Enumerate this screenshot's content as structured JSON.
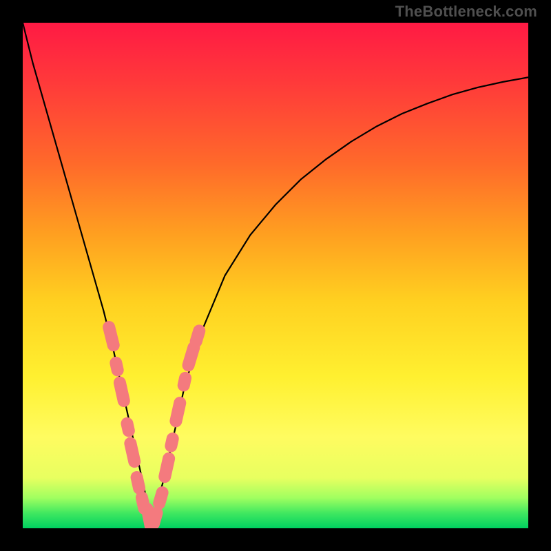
{
  "watermark": "TheBottleneck.com",
  "chart_data": {
    "type": "line",
    "title": "",
    "xlabel": "",
    "ylabel": "",
    "xlim": [
      0,
      100
    ],
    "ylim": [
      0,
      100
    ],
    "series": [
      {
        "name": "curve",
        "x": [
          0,
          2,
          4,
          6,
          8,
          10,
          12,
          14,
          16,
          18,
          20,
          22,
          24,
          25,
          26,
          28,
          30,
          32,
          35,
          40,
          45,
          50,
          55,
          60,
          65,
          70,
          75,
          80,
          85,
          90,
          95,
          100
        ],
        "y": [
          100,
          92,
          85,
          78,
          71,
          64,
          57,
          50,
          43,
          35,
          26,
          17,
          8,
          3,
          3,
          10,
          19,
          28,
          38,
          50,
          58,
          64,
          69,
          73,
          76.5,
          79.5,
          82,
          84,
          85.8,
          87.2,
          88.3,
          89.2
        ]
      }
    ],
    "markers_left": [
      {
        "x": 17.5,
        "y": 38,
        "len": 5
      },
      {
        "x": 18.6,
        "y": 32,
        "len": 2
      },
      {
        "x": 19.6,
        "y": 27,
        "len": 5
      },
      {
        "x": 20.8,
        "y": 20,
        "len": 2
      },
      {
        "x": 21.7,
        "y": 15,
        "len": 5
      },
      {
        "x": 22.8,
        "y": 9,
        "len": 3
      },
      {
        "x": 23.8,
        "y": 5,
        "len": 3
      }
    ],
    "markers_right": [
      {
        "x": 27.3,
        "y": 6,
        "len": 3
      },
      {
        "x": 28.5,
        "y": 12,
        "len": 5
      },
      {
        "x": 29.5,
        "y": 17,
        "len": 2
      },
      {
        "x": 30.7,
        "y": 23,
        "len": 5
      },
      {
        "x": 32.0,
        "y": 29,
        "len": 2
      },
      {
        "x": 33.3,
        "y": 34,
        "len": 5
      },
      {
        "x": 34.6,
        "y": 38,
        "len": 3
      }
    ],
    "markers_bottom": [
      {
        "x": 25.0,
        "y": 2,
        "len": 5
      },
      {
        "x": 26.2,
        "y": 2,
        "len": 3
      }
    ],
    "background_gradient": {
      "top": "#ff1a44",
      "mid": "#ffd020",
      "bottom": "#00d060"
    }
  }
}
